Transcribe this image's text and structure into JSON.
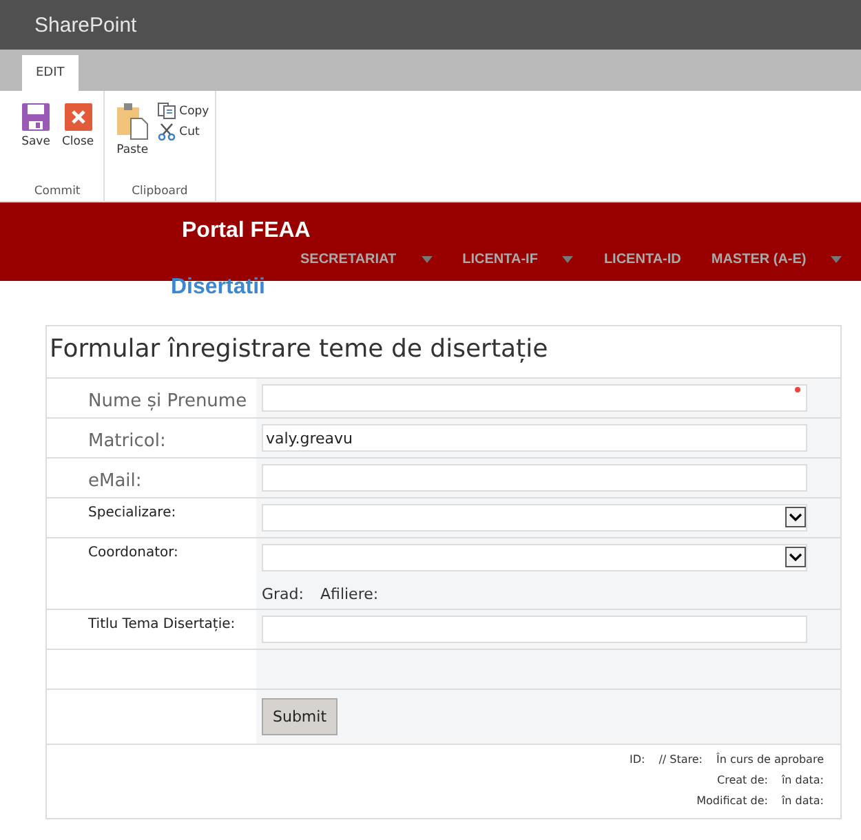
{
  "app_bar": {
    "title": "SharePoint"
  },
  "tabs": [
    {
      "label": "EDIT",
      "selected": true
    }
  ],
  "ribbon": {
    "groups": [
      {
        "label": "Commit",
        "buttons": [
          {
            "kind": "save",
            "label": "Save"
          },
          {
            "kind": "close",
            "label": "Close"
          }
        ]
      },
      {
        "label": "Clipboard",
        "buttons": [
          {
            "kind": "paste",
            "label": "Paste"
          },
          {
            "kind": "copy",
            "label": "Copy"
          },
          {
            "kind": "cut",
            "label": "Cut"
          }
        ]
      }
    ]
  },
  "banner": {
    "title": "Portal FEAA",
    "nav": [
      {
        "label": "SECRETARIAT",
        "has_dropdown": true
      },
      {
        "label": "LICENTA-IF",
        "has_dropdown": true
      },
      {
        "label": "LICENTA-ID",
        "has_dropdown": false
      },
      {
        "label": "MASTER (A-E)",
        "has_dropdown": true
      }
    ]
  },
  "page_title": "Disertatii",
  "form": {
    "title": "Formular înregistrare teme de disertație",
    "fields": [
      {
        "kind": "text",
        "label": "Nume și Prenume",
        "large_label": true,
        "required": true
      },
      {
        "kind": "text",
        "label": "Matricol:",
        "large_label": true,
        "value": "valy.greavu",
        "required": false
      },
      {
        "kind": "text",
        "label": "eMail:",
        "large_label": true,
        "required": false
      },
      {
        "kind": "select",
        "label": "Specializare:",
        "large_label": false
      },
      {
        "kind": "select",
        "label": "Coordonator:",
        "large_label": false,
        "info": [
          "Grad:",
          "Afiliere:"
        ]
      },
      {
        "kind": "text",
        "label": "Titlu Tema Disertație:",
        "large_label": false,
        "required": false
      },
      {
        "kind": "blank"
      },
      {
        "kind": "submit",
        "button": "Submit"
      }
    ],
    "meta": [
      [
        "ID:",
        "// Stare:",
        "În curs de aprobare"
      ],
      [
        "Creat de:",
        "în data:"
      ],
      [
        "Modificat de:",
        "în data:"
      ]
    ]
  }
}
